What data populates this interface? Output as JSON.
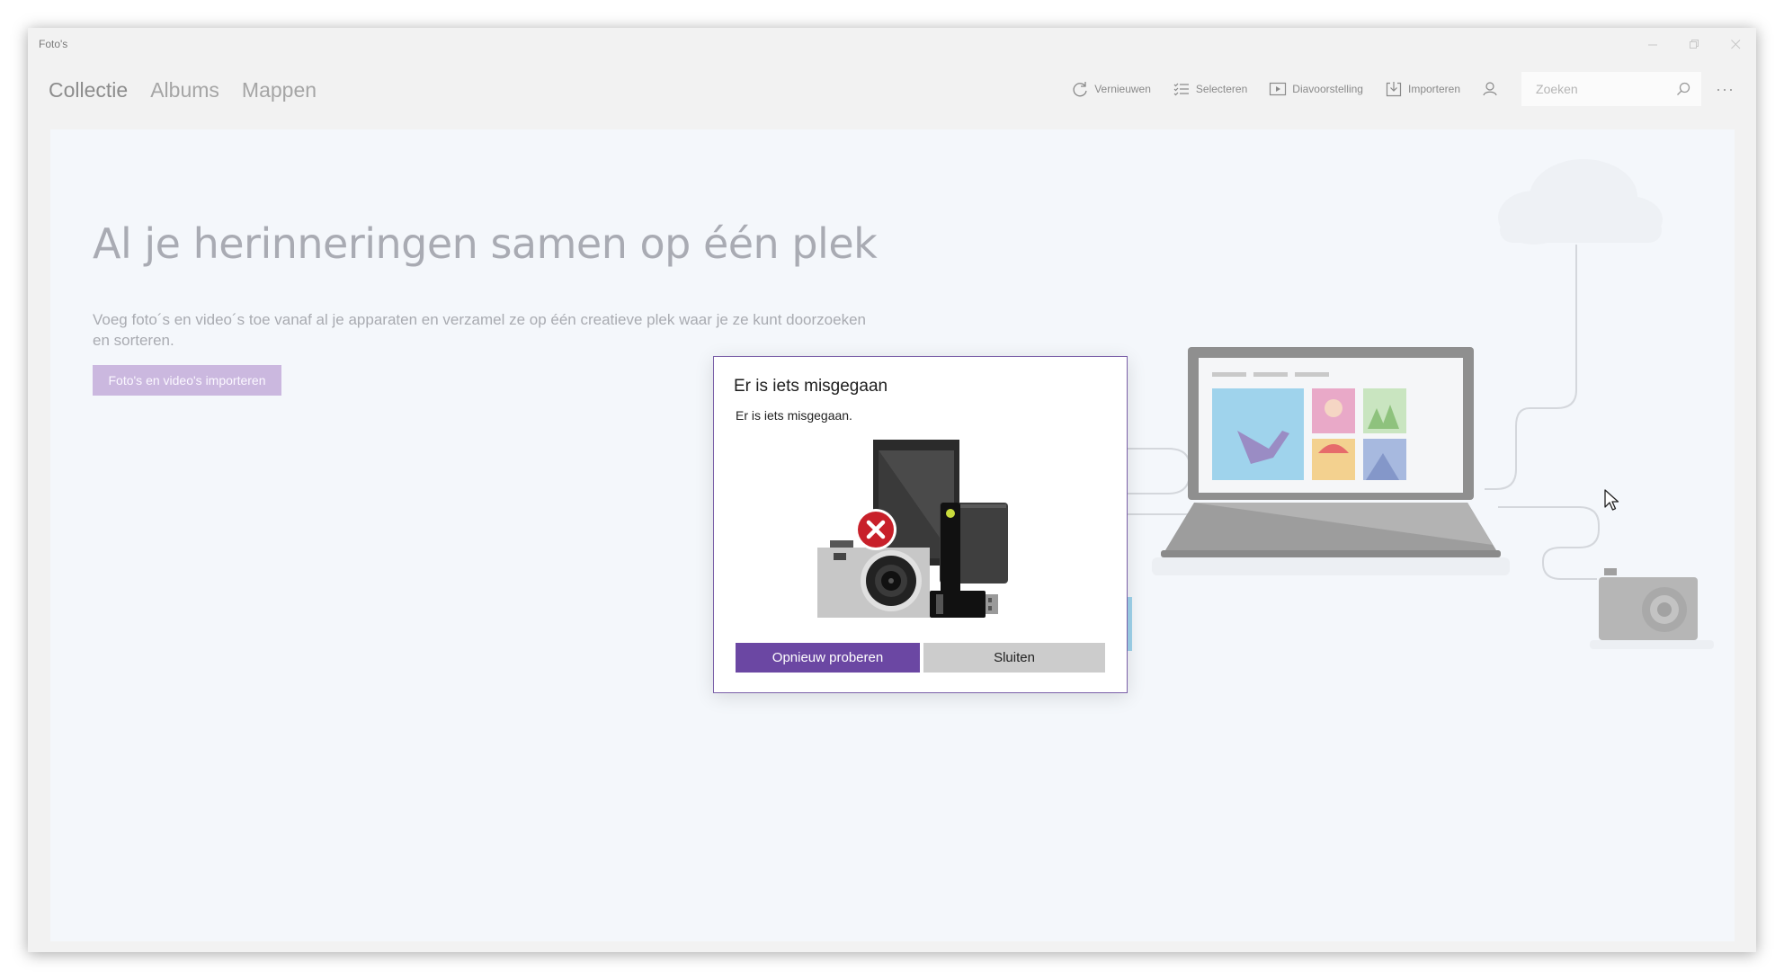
{
  "window": {
    "title": "Foto's"
  },
  "nav": {
    "tabs": [
      {
        "label": "Collectie",
        "active": true
      },
      {
        "label": "Albums",
        "active": false
      },
      {
        "label": "Mappen",
        "active": false
      }
    ]
  },
  "toolbar": {
    "refresh_label": "Vernieuwen",
    "select_label": "Selecteren",
    "slideshow_label": "Diavoorstelling",
    "import_label": "Importeren",
    "search_placeholder": "Zoeken"
  },
  "hero": {
    "title": "Al je herinneringen samen op één plek",
    "description": "Voeg foto´s en video´s toe vanaf al je apparaten en verzamel ze op één creatieve plek waar je ze kunt doorzoeken en sorteren.",
    "import_button": "Foto's en video's importeren"
  },
  "dialog": {
    "title": "Er is iets misgegaan",
    "message": "Er is iets misgegaan.",
    "retry_button": "Opnieuw proberen",
    "close_button": "Sluiten"
  },
  "colors": {
    "accent": "#6b47a3",
    "accent_light": "#cbb8df",
    "content_bg": "#f4f7fb",
    "error_red": "#c8202a"
  }
}
